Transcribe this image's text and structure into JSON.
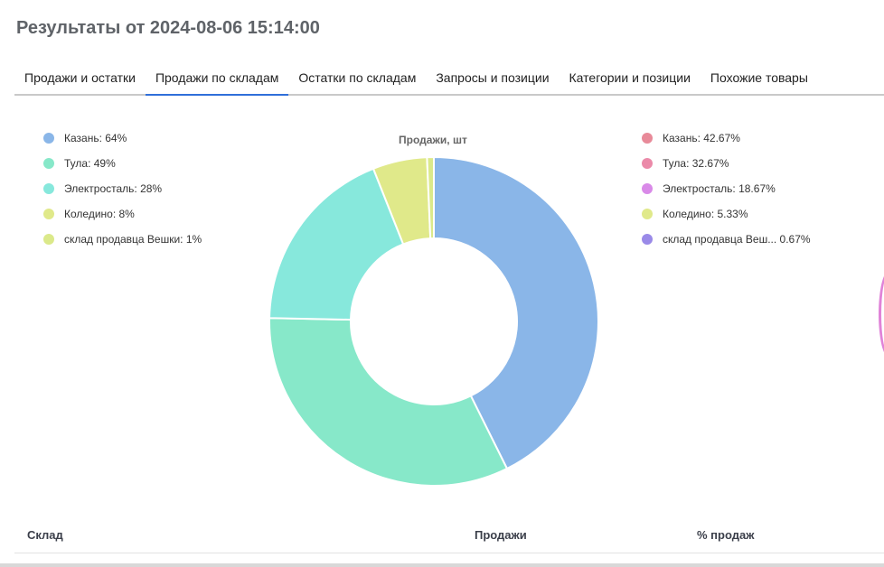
{
  "header": {
    "title": "Результаты от 2024-08-06 15:14:00"
  },
  "tabs": [
    {
      "label": "Продажи и остатки",
      "active": false
    },
    {
      "label": "Продажи по складам",
      "active": true
    },
    {
      "label": "Остатки по складам",
      "active": false
    },
    {
      "label": "Запросы и позиции",
      "active": false
    },
    {
      "label": "Категории и позиции",
      "active": false
    },
    {
      "label": "Похожие товары",
      "active": false
    }
  ],
  "left_legend": [
    {
      "label": "Казань:  64%",
      "color": "#8ab6e8"
    },
    {
      "label": "Тула:  49%",
      "color": "#87e8c9"
    },
    {
      "label": "Электросталь:  28%",
      "color": "#87e8dc"
    },
    {
      "label": "Коледино:  8%",
      "color": "#e0e98a"
    },
    {
      "label": "склад продавца Вешки:  1%",
      "color": "#dbe98a"
    }
  ],
  "right_legend": [
    {
      "label": "Казань:  42.67%",
      "color": "#e88a99"
    },
    {
      "label": "Тула:  32.67%",
      "color": "#eb8aa9"
    },
    {
      "label": "Электросталь:  18.67%",
      "color": "#d98ae8"
    },
    {
      "label": "Коледино:  5.33%",
      "color": "#e0e98a"
    },
    {
      "label": "склад продавца Веш...   0.67%",
      "color": "#9a8ae8"
    }
  ],
  "chart_data": {
    "type": "pie",
    "title": "Продажи, шт",
    "categories": [
      "Казань",
      "Тула",
      "Электросталь",
      "Коледино",
      "склад продавца Вешки"
    ],
    "values": [
      64,
      49,
      28,
      8,
      1
    ],
    "colors": [
      "#8ab6e8",
      "#87e8c9",
      "#87e8dc",
      "#e0e98a",
      "#dbe98a"
    ]
  },
  "table": {
    "headers": [
      "Склад",
      "Продажи",
      "% продаж"
    ]
  }
}
